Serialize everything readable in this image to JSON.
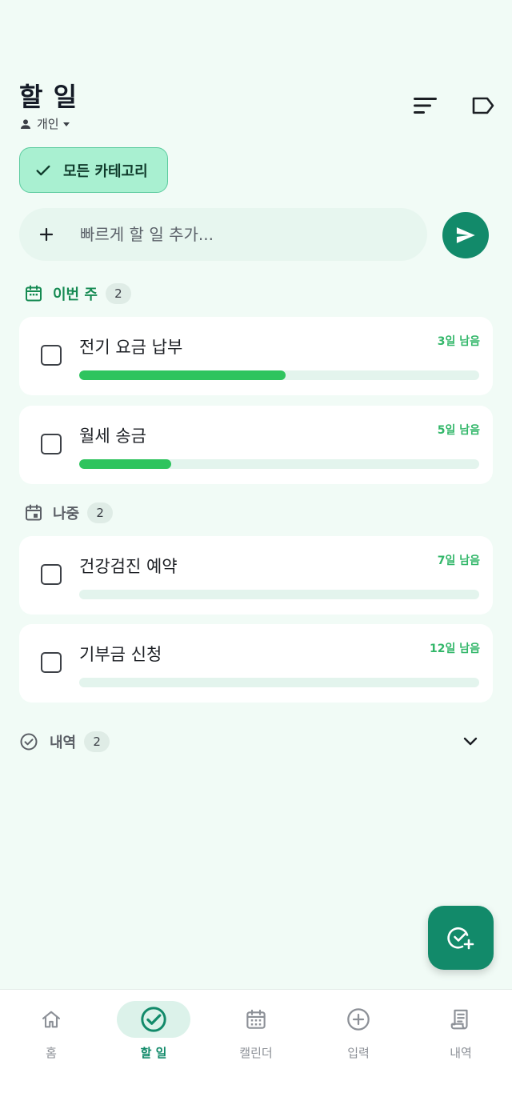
{
  "header": {
    "title": "할 일",
    "account": "개인"
  },
  "filter": {
    "label": "모든 카테고리"
  },
  "quick_add": {
    "placeholder": "빠르게 할 일 추가..."
  },
  "sections": {
    "this_week": {
      "label": "이번 주",
      "count": "2"
    },
    "later": {
      "label": "나중",
      "count": "2"
    },
    "history": {
      "label": "내역",
      "count": "2"
    }
  },
  "tasks": [
    {
      "title": "전기 요금 납부",
      "due": "3일 남음",
      "progress": 0.515
    },
    {
      "title": "월세 송금",
      "due": "5일 남음",
      "progress": 0.23
    },
    {
      "title": "건강검진 예약",
      "due": "7일 남음",
      "progress": 0
    },
    {
      "title": "기부금 신청",
      "due": "12일 남음",
      "progress": 0
    }
  ],
  "nav": [
    {
      "label": "홈",
      "icon": "home-icon"
    },
    {
      "label": "할 일",
      "icon": "check-circle-icon",
      "active": true
    },
    {
      "label": "캘린더",
      "icon": "calendar-icon"
    },
    {
      "label": "입력",
      "icon": "plus-circle-icon"
    },
    {
      "label": "내역",
      "icon": "receipt-icon"
    }
  ],
  "colors": {
    "accent": "#128a6a",
    "progress": "#2ec45e",
    "due_text": "#33b76a",
    "this_week_label": "#158a52",
    "background": "#f1fbf6"
  }
}
